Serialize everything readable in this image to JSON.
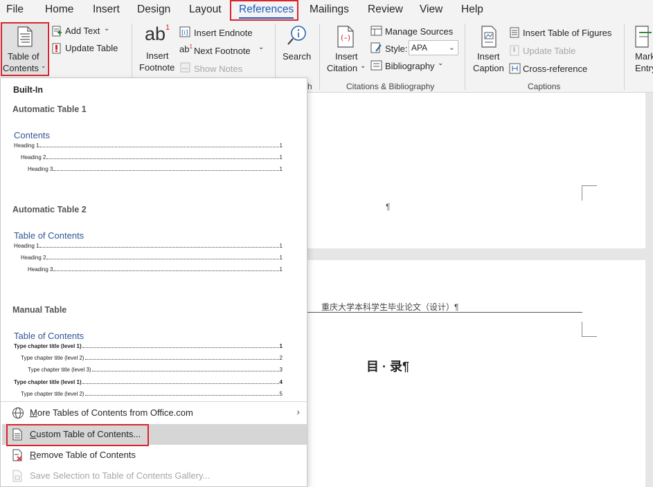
{
  "menu": {
    "tabs": [
      "File",
      "Home",
      "Insert",
      "Design",
      "Layout",
      "References",
      "Mailings",
      "Review",
      "View",
      "Help"
    ],
    "active": "References"
  },
  "ribbon": {
    "toc": {
      "label1": "Table of",
      "label2": "Contents",
      "add_text": "Add Text",
      "update_table": "Update Table"
    },
    "footnotes": {
      "insert_footnote1": "Insert",
      "insert_footnote2": "Footnote",
      "insert_endnote": "Insert Endnote",
      "next_footnote": "Next Footnote",
      "show_notes": "Show Notes",
      "footnote_glyph": "ab",
      "footnote_sup": "1"
    },
    "research": {
      "search": "Search",
      "group_label_fragment": "h"
    },
    "citations": {
      "insert_citation1": "Insert",
      "insert_citation2": "Citation",
      "manage_sources": "Manage Sources",
      "style_label": "Style:",
      "style_value": "APA",
      "bibliography": "Bibliography",
      "group_label": "Citations & Bibliography"
    },
    "captions": {
      "insert_caption1": "Insert",
      "insert_caption2": "Caption",
      "insert_table_of_figures": "Insert Table of Figures",
      "update_table": "Update Table",
      "cross_reference": "Cross-reference",
      "group_label": "Captions"
    },
    "index": {
      "mark_entry1": "Mark",
      "mark_entry2": "Entry"
    }
  },
  "document": {
    "paragraph_mark": "¶",
    "header_text": "重庆大学本科学生毕业论文（设计）¶",
    "toc_heading": "目 · 录¶"
  },
  "dropdown": {
    "builtin": "Built-In",
    "auto1": {
      "name": "Automatic Table 1",
      "title": "Contents",
      "lines": [
        {
          "label": "Heading 1",
          "num": "1"
        },
        {
          "label": "Heading 2",
          "num": "1"
        },
        {
          "label": "Heading 3",
          "num": "1"
        }
      ]
    },
    "auto2": {
      "name": "Automatic Table 2",
      "title": "Table of Contents",
      "lines": [
        {
          "label": "Heading 1",
          "num": "1"
        },
        {
          "label": "Heading 2",
          "num": "1"
        },
        {
          "label": "Heading 3",
          "num": "1"
        }
      ]
    },
    "manual": {
      "name": "Manual Table",
      "title": "Table of Contents",
      "lines": [
        {
          "label": "Type chapter title (level 1)",
          "num": "1"
        },
        {
          "label": "Type chapter title (level 2)",
          "num": "2"
        },
        {
          "label": "Type chapter title (level 3)",
          "num": "3"
        },
        {
          "label": "Type chapter title (level 1)",
          "num": "4"
        },
        {
          "label": "Type chapter title (level 2)",
          "num": "5"
        }
      ]
    },
    "items": {
      "more": {
        "u": "M",
        "rest": "ore Tables of Contents from Office.com"
      },
      "custom": {
        "u": "C",
        "rest": "ustom Table of Contents..."
      },
      "remove": {
        "u": "R",
        "rest": "emove Table of Contents"
      },
      "save": {
        "text": "Save Selection to Table of Contents Gallery..."
      }
    }
  },
  "colors": {
    "accent": "#185abd",
    "highlight_box": "#d9232d",
    "toc_title": "#2f5496"
  }
}
